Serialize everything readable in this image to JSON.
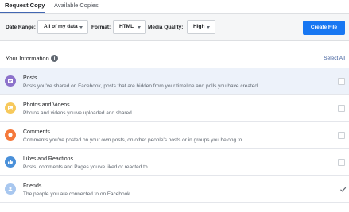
{
  "tabs": [
    {
      "label": "Request Copy",
      "active": true
    },
    {
      "label": "Available Copies",
      "active": false
    }
  ],
  "toolbar": {
    "date_range_label": "Date Range:",
    "date_range_value": "All of my data",
    "format_label": "Format:",
    "format_value": "HTML",
    "media_quality_label": "Media Quality:",
    "media_quality_value": "High",
    "create_button": "Create File"
  },
  "section": {
    "title": "Your Information",
    "info_icon": "i",
    "select_all": "Select All"
  },
  "rows": [
    {
      "title": "Posts",
      "desc": "Posts you've shared on Facebook, posts that are hidden from your timeline and polls you have created",
      "icon": "posts-icon",
      "color": "#8c72cb",
      "checked": false,
      "highlight": true
    },
    {
      "title": "Photos and Videos",
      "desc": "Photos and videos you've uploaded and shared",
      "icon": "photos-icon",
      "color": "#f7c95c",
      "checked": false,
      "highlight": false
    },
    {
      "title": "Comments",
      "desc": "Comments you've posted on your own posts, on other people's posts or in groups you belong to",
      "icon": "comments-icon",
      "color": "#f5793b",
      "checked": false,
      "highlight": false
    },
    {
      "title": "Likes and Reactions",
      "desc": "Posts, comments and Pages you've liked or reacted to",
      "icon": "like-icon",
      "color": "#4a90d9",
      "checked": false,
      "highlight": false
    },
    {
      "title": "Friends",
      "desc": "The people you are connected to on Facebook",
      "icon": "friends-icon",
      "color": "#a8c7ef",
      "checked": true,
      "highlight": false
    }
  ],
  "colors": {
    "accent": "#1877f2",
    "link": "#385898"
  }
}
